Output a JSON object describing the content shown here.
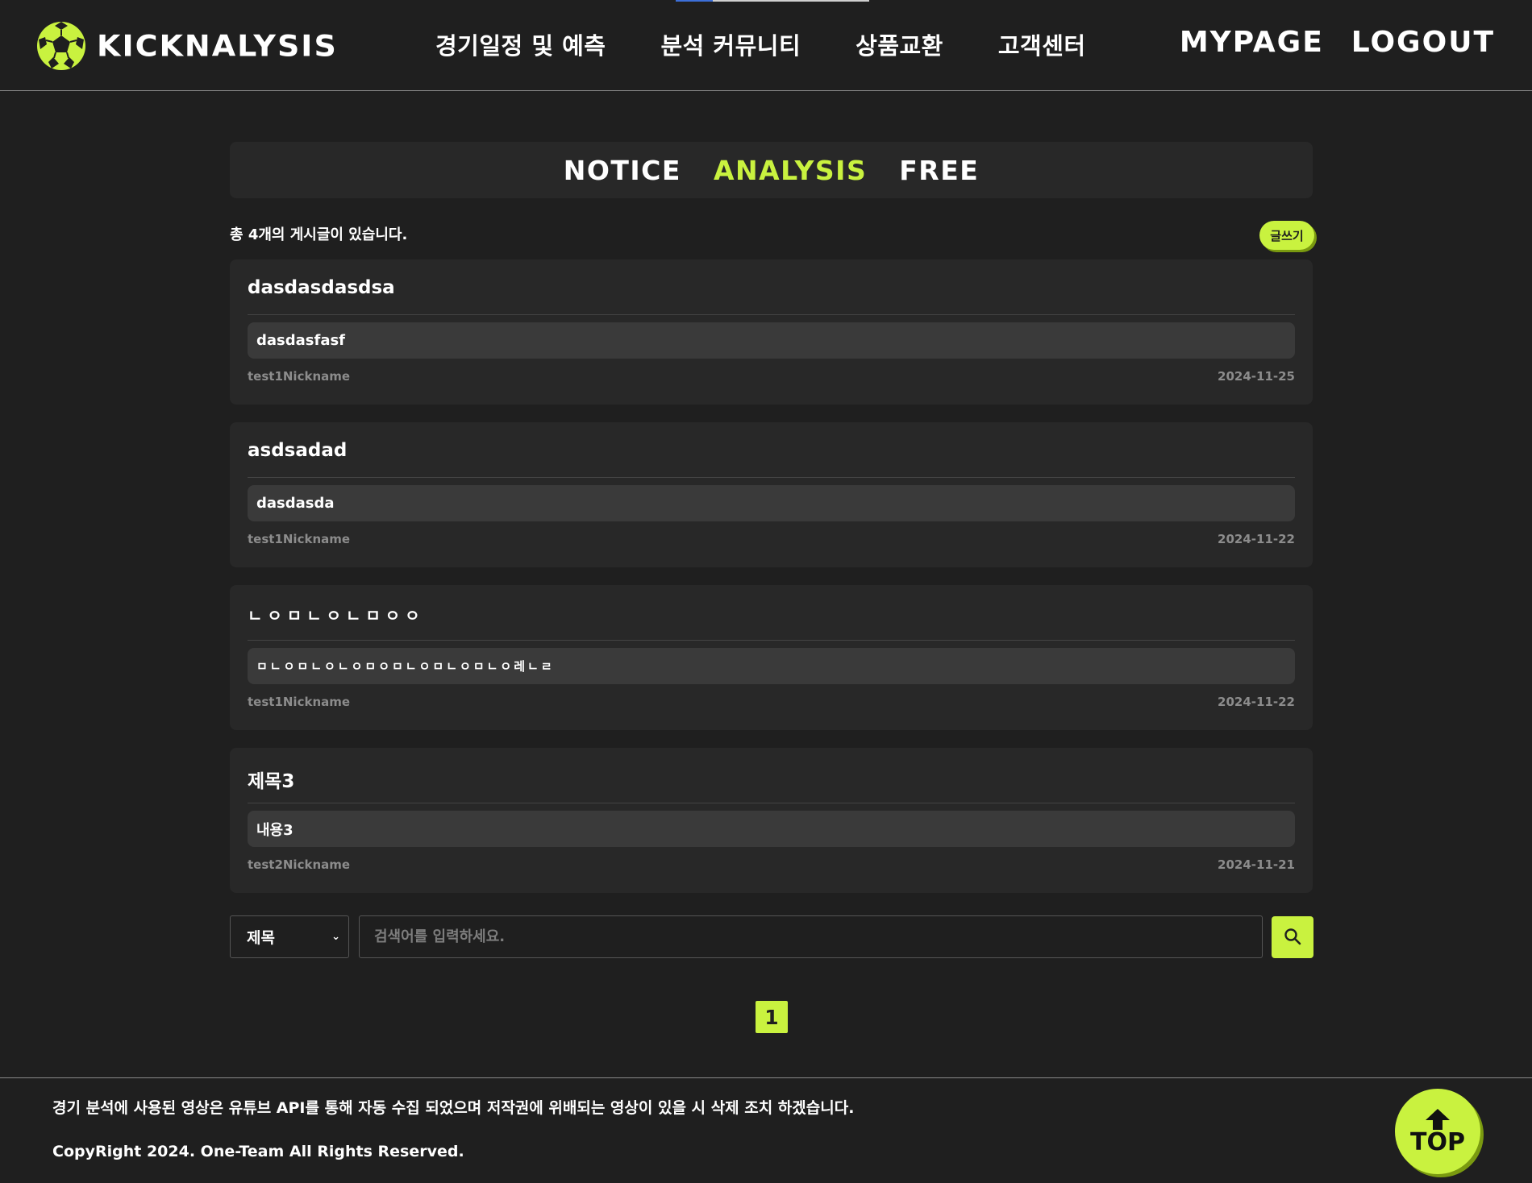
{
  "header": {
    "brand": "KICKNALYSIS",
    "nav": [
      "경기일정 및 예측",
      "분석 커뮤니티",
      "상품교환",
      "고객센터"
    ],
    "user_nav": {
      "mypage": "MYPAGE",
      "logout": "LOGOUT"
    }
  },
  "board": {
    "tabs": [
      "NOTICE",
      "ANALYSIS",
      "FREE"
    ],
    "active_tab": "ANALYSIS",
    "post_count_text": "총 4개의 게시글이 있습니다.",
    "write_label": "글쓰기"
  },
  "posts": [
    {
      "title": "dasdasdasdsa",
      "body": "dasdasfasf",
      "author": "test1Nickname",
      "date": "2024-11-25"
    },
    {
      "title": "asdsadad",
      "body": "dasdasda",
      "author": "test1Nickname",
      "date": "2024-11-22"
    },
    {
      "title": "ㄴㅇㅁㄴㅇㄴㅁㅇㅇ",
      "body": "ㅁㄴㅇㅁㄴㅇㄴㅇㅁㅇㅁㄴㅇㅁㄴㅇㅁㄴㅇ레ㄴㄹ",
      "author": "test1Nickname",
      "date": "2024-11-22"
    },
    {
      "title": "제목3",
      "body": "내용3",
      "author": "test2Nickname",
      "date": "2024-11-21"
    }
  ],
  "search": {
    "field_selected": "제목",
    "placeholder": "검색어를 입력하세요."
  },
  "pagination": {
    "current_page": "1"
  },
  "footer": {
    "notice": "경기 분석에 사용된 영상은 유튜브 API를 통해 자동 수집 되었으며 저작권에 위배되는 영상이 있을 시 삭제 조치 하겠습니다.",
    "copyright": "CopyRight 2024. One-Team All Rights Reserved.",
    "top_label": "TOP"
  },
  "colors": {
    "accent": "#c9f23f",
    "background": "#1f1f1f",
    "card": "#282828"
  }
}
